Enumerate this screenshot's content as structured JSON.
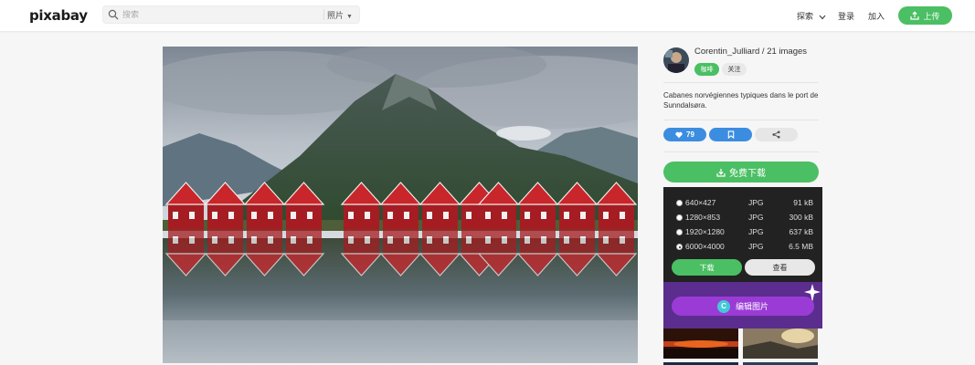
{
  "header": {
    "logo": "pixabay",
    "search_placeholder": "搜索",
    "search_type": "照片",
    "nav_explore": "探索",
    "nav_login": "登录",
    "nav_join": "加入",
    "upload_label": "上传"
  },
  "author": {
    "line": "Corentin_Julliard / 21 images",
    "coffee_label": "咖啡",
    "follow_label": "关注"
  },
  "description": "Cabanes norvégiennes typiques dans le port de Sunndalsøra.",
  "actions": {
    "like_count": "79"
  },
  "download": {
    "button_label": "免费下载",
    "options": [
      {
        "resolution": "640×427",
        "format": "JPG",
        "size": "91 kB"
      },
      {
        "resolution": "1280×853",
        "format": "JPG",
        "size": "300 kB"
      },
      {
        "resolution": "1920×1280",
        "format": "JPG",
        "size": "637 kB"
      },
      {
        "resolution": "6000×4000",
        "format": "JPG",
        "size": "6.5 MB"
      }
    ],
    "selected_index": 3,
    "panel_download_label": "下载",
    "panel_view_label": "查看"
  },
  "edit": {
    "label": "编辑图片",
    "logo_letter": "C"
  },
  "colors": {
    "green": "#4bbf63",
    "blue": "#3b8de0",
    "panel_dark": "#222222",
    "edit_purple": "#9b3bd6"
  },
  "icons": [
    "search-icon",
    "chevron-down-icon",
    "upload-icon",
    "heart-icon",
    "bookmark-icon",
    "share-icon",
    "download-icon",
    "sparkle-icon"
  ]
}
